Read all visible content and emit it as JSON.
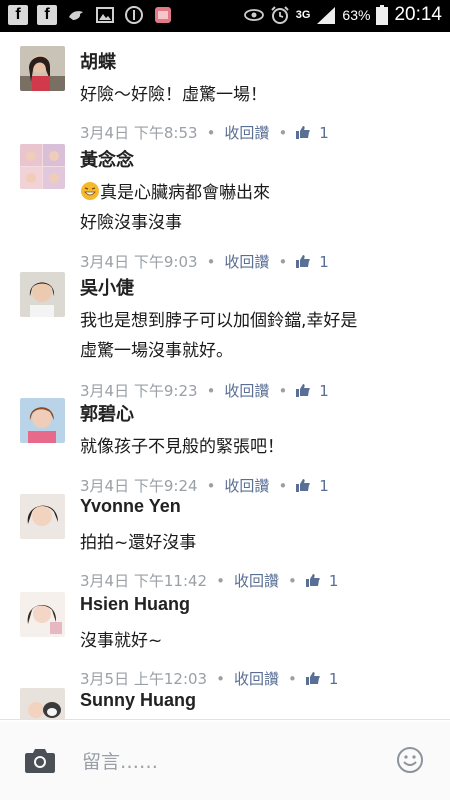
{
  "status_bar": {
    "network": "3G",
    "battery": "63%",
    "time": "20:14"
  },
  "comments": [
    {
      "name": "胡蝶",
      "lines": [
        "好險～好險！虛驚一場！"
      ],
      "date": "3月4日",
      "time": "下午8:53",
      "retract": "收回讚",
      "likes": "1"
    },
    {
      "name": "黃念念",
      "lines": [
        "真是心臟病都會嚇出來",
        "好險沒事沒事"
      ],
      "date": "3月4日",
      "time": "下午9:03",
      "retract": "收回讚",
      "likes": "1"
    },
    {
      "name": "吳小倢",
      "lines": [
        "我也是想到脖子可以加個鈴鐺,幸好是",
        "虛驚一場沒事就好。"
      ],
      "date": "3月4日",
      "time": "下午9:23",
      "retract": "收回讚",
      "likes": "1"
    },
    {
      "name": "郭碧心",
      "lines": [
        "就像孩子不見般的緊張吧！"
      ],
      "date": "3月4日",
      "time": "下午9:24",
      "retract": "收回讚",
      "likes": "1"
    },
    {
      "name": "Yvonne Yen",
      "lines": [
        "拍拍~還好沒事"
      ],
      "date": "3月4日",
      "time": "下午11:42",
      "retract": "收回讚",
      "likes": "1"
    },
    {
      "name": "Hsien Huang",
      "lines": [
        "沒事就好~"
      ],
      "date": "3月5日",
      "time": "上午12:03",
      "retract": "收回讚",
      "likes": "1"
    },
    {
      "name": "Sunny Huang"
    }
  ],
  "composer": {
    "placeholder": "留言……"
  },
  "colors": {
    "link": "#5a6f96",
    "meta": "#9aa0a6"
  }
}
